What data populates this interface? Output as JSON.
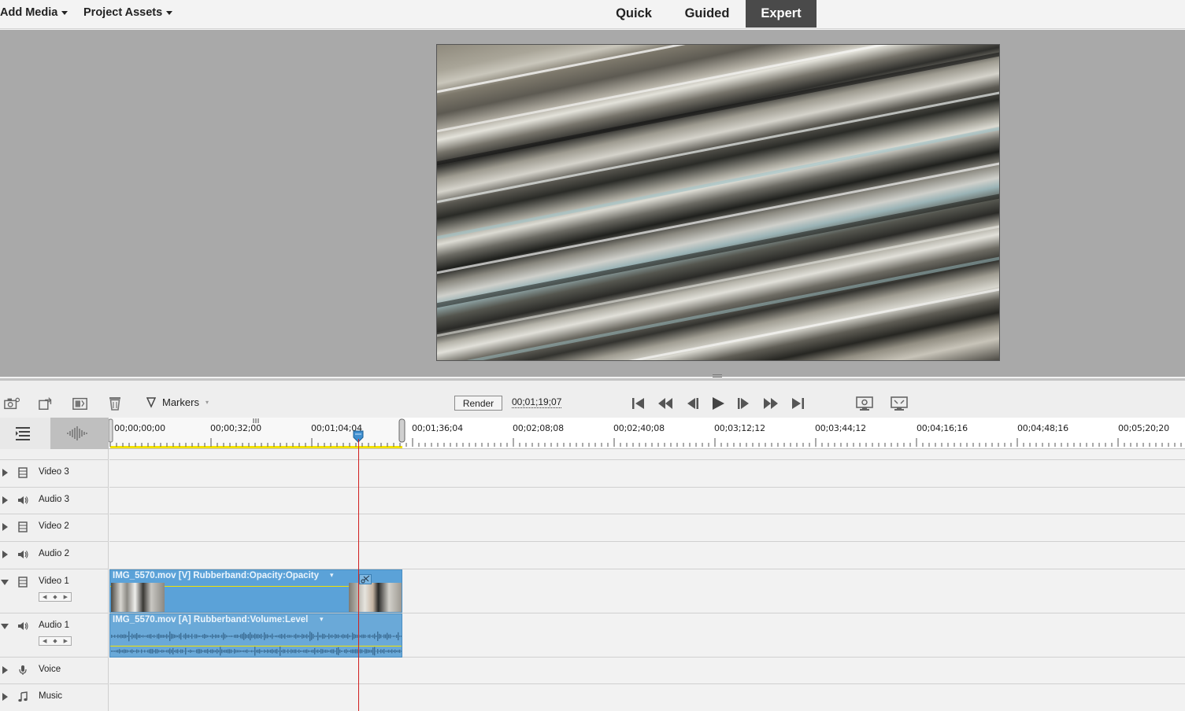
{
  "topbar": {
    "add_media": "Add Media",
    "project_assets": "Project Assets",
    "modes": [
      "Quick",
      "Guided",
      "Expert"
    ],
    "active_mode": "Expert"
  },
  "toolbar": {
    "markers_label": "Markers",
    "render_label": "Render",
    "timecode": "00;01;19;07"
  },
  "ruler": {
    "labels": [
      "00;00;00;00",
      "00;00;32;00",
      "00;01;04;04",
      "00;01;36;04",
      "00;02;08;08",
      "00;02;40;08",
      "00;03;12;12",
      "00;03;44;12",
      "00;04;16;16",
      "00;04;48;16",
      "00;05;20;20"
    ]
  },
  "tracks": {
    "video3": "Video 3",
    "audio3": "Audio 3",
    "video2": "Video 2",
    "audio2": "Audio 2",
    "video1": "Video 1",
    "audio1": "Audio 1",
    "voice": "Voice",
    "music": "Music"
  },
  "clips": {
    "video_title": "IMG_5570.mov [V]  Rubberband:Opacity:Opacity",
    "audio_title": "IMG_5570.mov [A]  Rubberband:Volume:Level"
  },
  "colors": {
    "clip": "#5ba2d8",
    "playhead": "#d11f1f",
    "workarea": "#f3e200",
    "active_mode_bg": "#4a4a4a"
  }
}
